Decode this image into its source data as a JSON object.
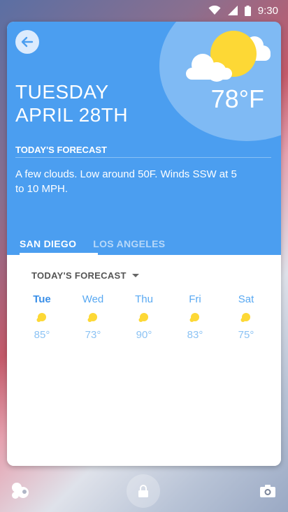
{
  "status_bar": {
    "time": "9:30",
    "icons": [
      "wifi-icon",
      "cellular-signal-icon",
      "battery-icon"
    ]
  },
  "card": {
    "day_name": "TUESDAY",
    "date": "APRIL 28TH",
    "temperature": "78°F",
    "section_label": "TODAY'S FORECAST",
    "summary": "A few clouds. Low around 50F. Winds SSW at 5 to 10 MPH.",
    "tabs": [
      {
        "label": "SAN DIEGO",
        "active": true
      },
      {
        "label": "LOS ANGELES",
        "active": false
      }
    ],
    "forecast_dropdown": "TODAY'S FORECAST",
    "forecast": [
      {
        "day": "Tue",
        "temp": "85°",
        "icon": "sun-icon"
      },
      {
        "day": "Wed",
        "temp": "73°",
        "icon": "sun-icon"
      },
      {
        "day": "Thu",
        "temp": "90°",
        "icon": "sun-icon"
      },
      {
        "day": "Fri",
        "temp": "83°",
        "icon": "sun-icon"
      },
      {
        "day": "Sat",
        "temp": "75°",
        "icon": "sun-icon"
      }
    ]
  },
  "colors": {
    "card_blue": "#4b9ef0",
    "sun_yellow": "#fdd835",
    "forecast_blue": "#59a9f2"
  }
}
